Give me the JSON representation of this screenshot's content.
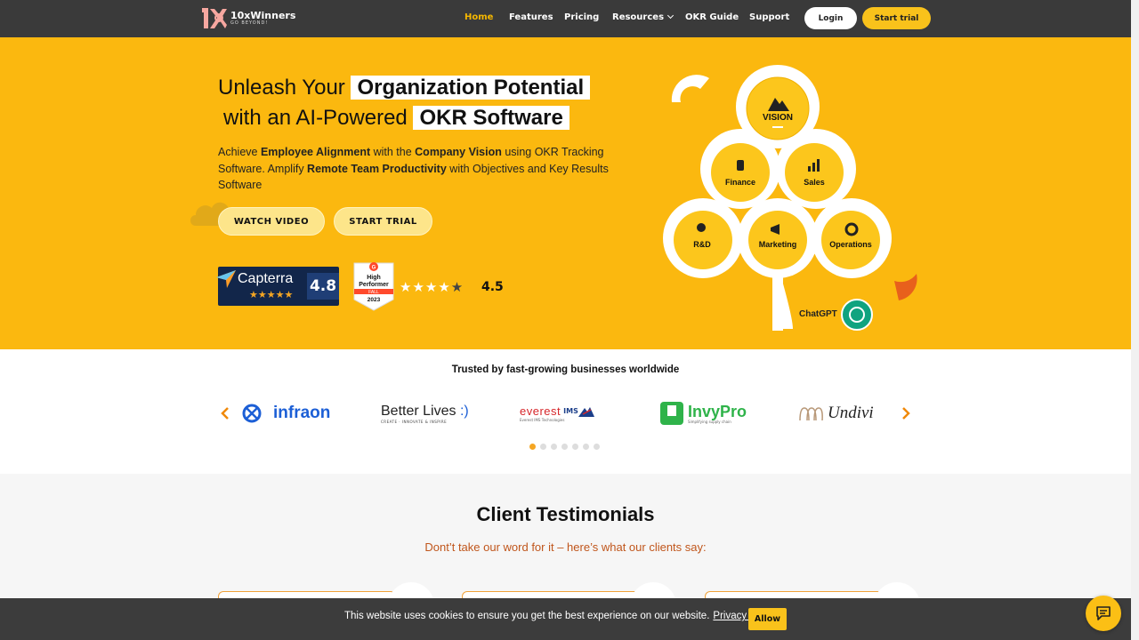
{
  "nav": {
    "logo_name": "10xWinners",
    "logo_tag": "GO BEYOND!",
    "links": [
      "Home",
      "Features",
      "Pricing",
      "Resources",
      "OKR Guide",
      "Support"
    ],
    "login": "Login",
    "start_trial": "Start trial"
  },
  "hero": {
    "line1_plain": "Unleash Your",
    "line1_highlight": "Organization Potential",
    "line2_plain": "with an AI-Powered",
    "line2_highlight": "OKR Software",
    "desc": [
      {
        "t": "Achieve ",
        "b": false
      },
      {
        "t": "Employee Alignment",
        "b": true
      },
      {
        "t": " with the ",
        "b": false
      },
      {
        "t": "Company Vision",
        "b": true
      },
      {
        "t": " using OKR Tracking Software. Amplify ",
        "b": false
      },
      {
        "t": "Remote Team Productivity",
        "b": true
      },
      {
        "t": " with Objectives and Key Results Software",
        "b": false
      }
    ],
    "watch_video": "WATCH VIDEO",
    "start_trial": "START TRIAL",
    "capterra_name": "Capterra",
    "capterra_score": "4.8",
    "g2_badge_line1": "High",
    "g2_badge_line2": "Performer",
    "g2_badge_season": "FALL",
    "g2_badge_year": "2023",
    "g2_score": "4.5",
    "g2_rating": 4.5,
    "tree": {
      "vision": "VISION",
      "finance": "Finance",
      "sales": "Sales",
      "rd": "R&D",
      "marketing": "Marketing",
      "operations": "Operations",
      "chatgpt": "ChatGPT"
    }
  },
  "trusted": {
    "title": "Trusted by fast-growing businesses worldwide",
    "brands": [
      "infraon",
      "Better Lives",
      "everest",
      "InvyPro",
      "Undivi"
    ],
    "better_lives_tag": "CREATE · INNOVATE & INSPIRE",
    "everest_tag": "Everest IMS Technologies",
    "invypro_tag": "Simplifying supply chain",
    "slide_count": 7,
    "active_slide": 0
  },
  "testimonials": {
    "title": "Client Testimonials",
    "subtitle": "Dont’t take our word for it – here’s what our clients say:"
  },
  "cookie": {
    "text": "This website uses cookies to ensure you get the best experience on our website.",
    "link": "Privacy policy",
    "allow": "Allow"
  },
  "colors": {
    "hero_bg": "#fbb80f",
    "nav_bg": "#3a3a3a",
    "accent": "#f9c21b"
  }
}
